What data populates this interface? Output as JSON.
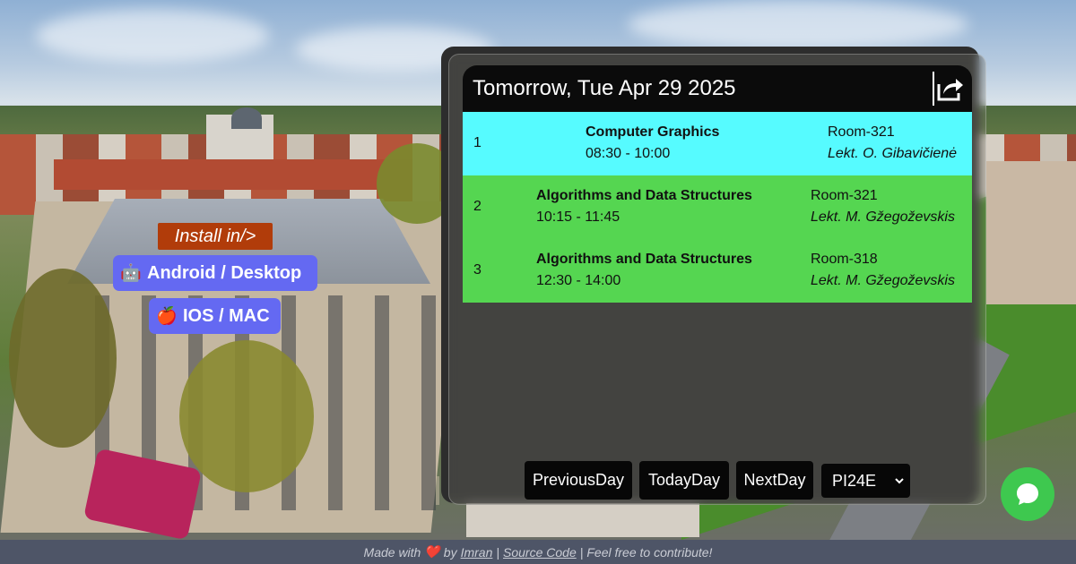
{
  "install": {
    "label": "Install in/>",
    "android": {
      "icon": "🤖",
      "label": "Android / Desktop"
    },
    "ios": {
      "icon": "🍎",
      "label": "IOS / MAC"
    }
  },
  "schedule": {
    "day_title": "Tomorrow, Tue Apr 29 2025",
    "share_icon": "share-icon",
    "lessons": [
      {
        "num": "1",
        "subject": "Computer Graphics",
        "time": "08:30 - 10:00",
        "room": "Room-321",
        "teacher": "Lekt. O. Gibavičienė",
        "color": "#56fbff"
      },
      {
        "num": "2",
        "subject": "Algorithms and Data Structures",
        "time": "10:15 - 11:45",
        "room": "Room-321",
        "teacher": "Lekt. M. Gžegoževskis",
        "color": "#55d651"
      },
      {
        "num": "3",
        "subject": "Algorithms and Data Structures",
        "time": "12:30 - 14:00",
        "room": "Room-318",
        "teacher": "Lekt. M. Gžegoževskis",
        "color": "#55d651"
      }
    ]
  },
  "nav": {
    "previous": "PreviousDay",
    "today": "TodayDay",
    "next": "NextDay",
    "group": "PI24E"
  },
  "footer": {
    "made_with": "Made with",
    "heart": "❤️",
    "by": "by",
    "author": "Imran",
    "separator1": "|",
    "source": "Source Code",
    "separator2": "|",
    "contribute": "Feel free to contribute!"
  }
}
